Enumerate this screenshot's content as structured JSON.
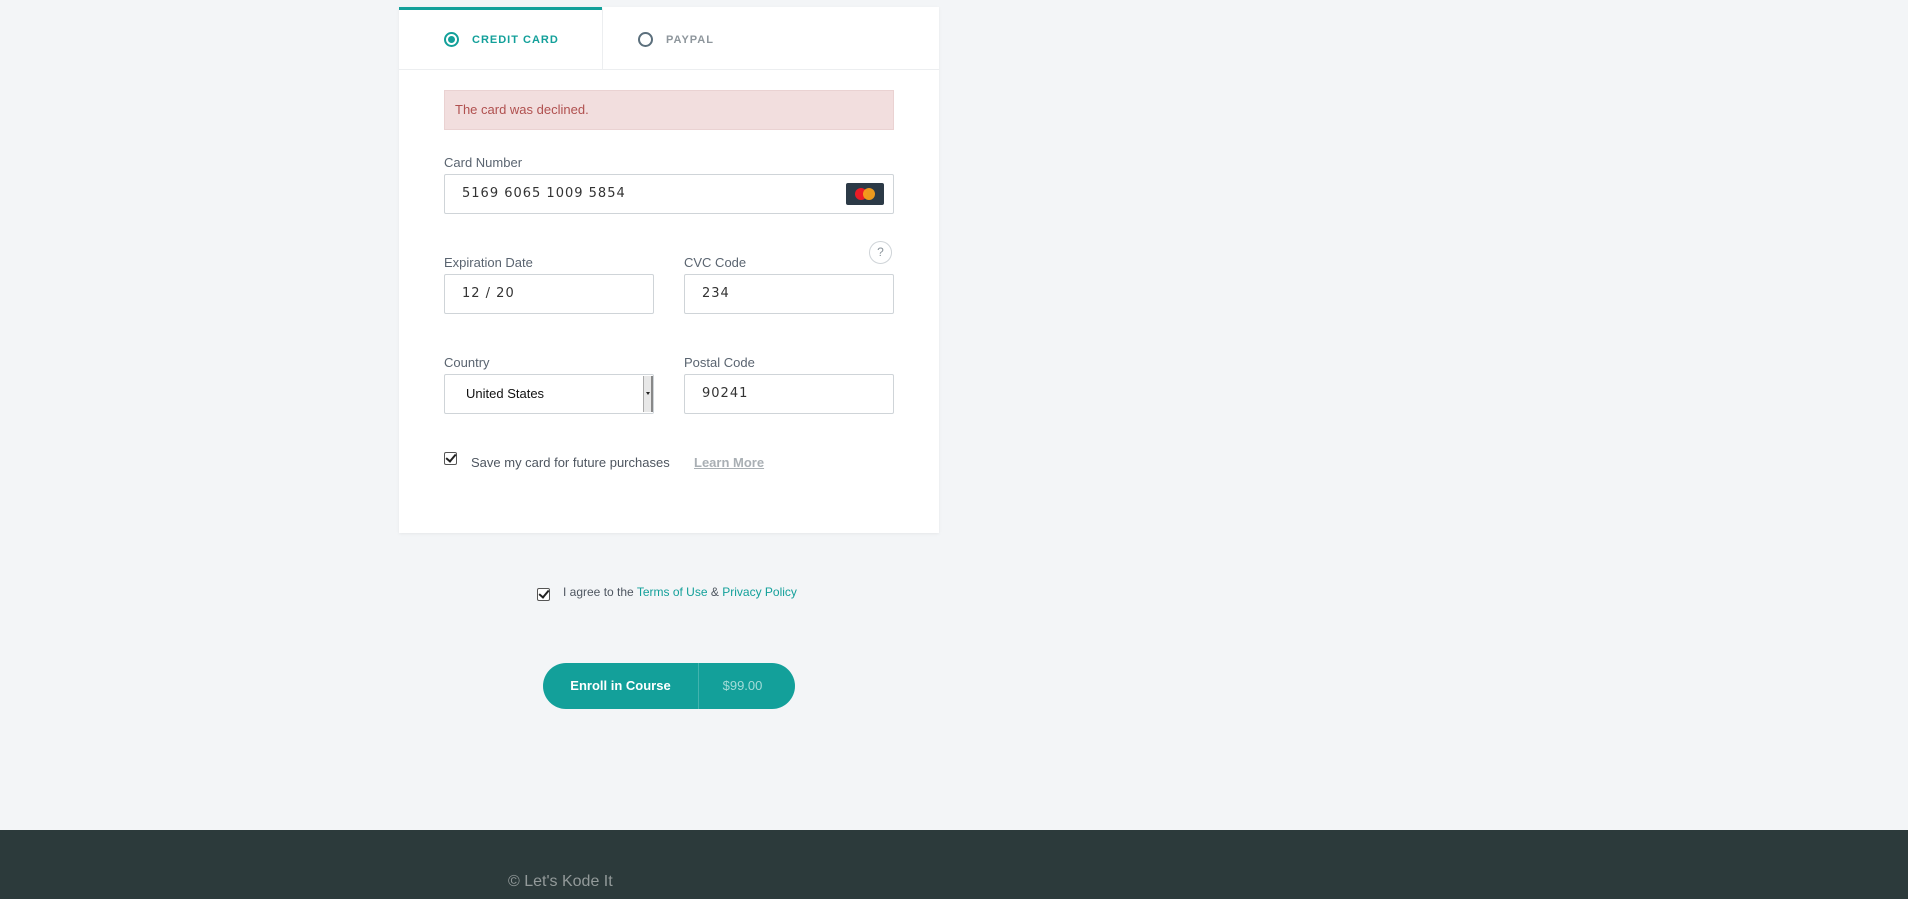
{
  "payment_tabs": {
    "credit_card_label": "CREDIT CARD",
    "paypal_label": "PAYPAL",
    "selected": "credit_card"
  },
  "error_message": "The card was declined.",
  "card_number": {
    "label": "Card Number",
    "value": "5169 6065 1009 5854",
    "brand_icon": "mastercard-icon"
  },
  "expiration": {
    "label": "Expiration Date",
    "value": "12 / 20"
  },
  "cvc": {
    "label": "CVC Code",
    "value": "234",
    "help_symbol": "?"
  },
  "country": {
    "label": "Country",
    "selected": "United States"
  },
  "postal": {
    "label": "Postal Code",
    "value": "90241"
  },
  "save_card": {
    "label": "Save my card for future purchases",
    "checked": true,
    "learn_more": "Learn More"
  },
  "terms": {
    "prefix": "I agree to the",
    "terms_link": "Terms of Use",
    "ampersand": "&",
    "privacy_link": "Privacy Policy",
    "checked": true
  },
  "enroll": {
    "label": "Enroll in Course",
    "price": "$99.00"
  },
  "footer": {
    "copyright": "© Let's Kode It"
  },
  "colors": {
    "accent": "#13a09a",
    "error_bg": "#f2dede",
    "error_text": "#b0504f",
    "footer_bg": "#2c3a3b"
  }
}
